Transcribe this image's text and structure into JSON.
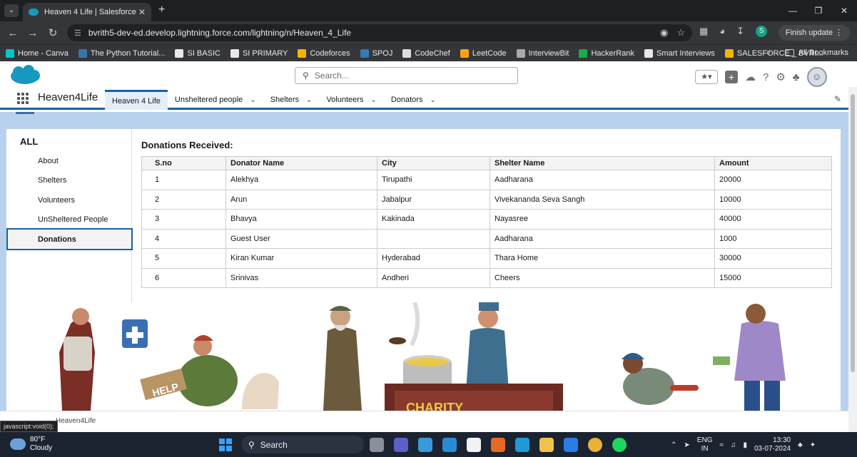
{
  "browser": {
    "tab_title": "Heaven 4 Life | Salesforce",
    "url": "bvrith5-dev-ed.develop.lightning.force.com/lightning/n/Heaven_4_Life",
    "finish_update": "Finish update",
    "profile_letter": "S",
    "bookmarks": [
      {
        "label": "Home - Canva",
        "color": "#00c4cc"
      },
      {
        "label": "The Python Tutorial...",
        "color": "#3776ab"
      },
      {
        "label": "SI BASIC",
        "color": "#e8e8e8"
      },
      {
        "label": "SI PRIMARY",
        "color": "#e8e8e8"
      },
      {
        "label": "Codeforces",
        "color": "#f4b400"
      },
      {
        "label": "SPOJ",
        "color": "#337ab7"
      },
      {
        "label": "CodeChef",
        "color": "#ddd"
      },
      {
        "label": "LeetCode",
        "color": "#ffa116"
      },
      {
        "label": "InterviewBit",
        "color": "#aaa"
      },
      {
        "label": "HackerRank",
        "color": "#1ba94c"
      },
      {
        "label": "Smart Interviews",
        "color": "#e8e8e8"
      },
      {
        "label": "SALESFORCE _ BVRI...",
        "color": "#f4b400"
      }
    ],
    "all_bookmarks": "All Bookmarks"
  },
  "sf": {
    "search_placeholder": "Search...",
    "app_name": "Heaven4Life",
    "nav_tabs": [
      {
        "label": "Heaven 4 Life",
        "active": true,
        "chevron": false
      },
      {
        "label": "Unsheltered people",
        "active": false,
        "chevron": true
      },
      {
        "label": "Shelters",
        "active": false,
        "chevron": true
      },
      {
        "label": "Volunteers",
        "active": false,
        "chevron": true
      },
      {
        "label": "Donators",
        "active": false,
        "chevron": true
      }
    ]
  },
  "sidebar": {
    "heading": "ALL",
    "items": [
      {
        "label": "About"
      },
      {
        "label": "Shelters"
      },
      {
        "label": "Volunteers"
      },
      {
        "label": "UnSheltered People"
      },
      {
        "label": "Donations",
        "selected": true
      }
    ]
  },
  "donations": {
    "title": "Donations Received:",
    "columns": [
      "S.no",
      "Donator Name",
      "City",
      "Shelter Name",
      "Amount"
    ],
    "rows": [
      [
        "1",
        "Alekhya",
        "Tirupathi",
        "Aadharana",
        "20000"
      ],
      [
        "2",
        "Arun",
        "Jabalpur",
        "Vivekananda Seva Sangh",
        "10000"
      ],
      [
        "3",
        "Bhavya",
        "Kakinada",
        "Nayasree",
        "40000"
      ],
      [
        "4",
        "Guest User",
        "",
        "Aadharana",
        "1000"
      ],
      [
        "5",
        "Kiran Kumar",
        "Hyderabad",
        "Thara Home",
        "30000"
      ],
      [
        "6",
        "Srinivas",
        "Andheri",
        "Cheers",
        "15000"
      ]
    ]
  },
  "illustration": {
    "sign_text": "HELP",
    "banner_text": "CHARITY"
  },
  "footer": {
    "status_link": "javascript:void(0);",
    "app_label": "Heaven4Life"
  },
  "taskbar": {
    "temp": "80°F",
    "condition": "Cloudy",
    "search": "Search",
    "lang1": "ENG",
    "lang2": "IN",
    "time": "13:30",
    "date": "03-07-2024"
  }
}
